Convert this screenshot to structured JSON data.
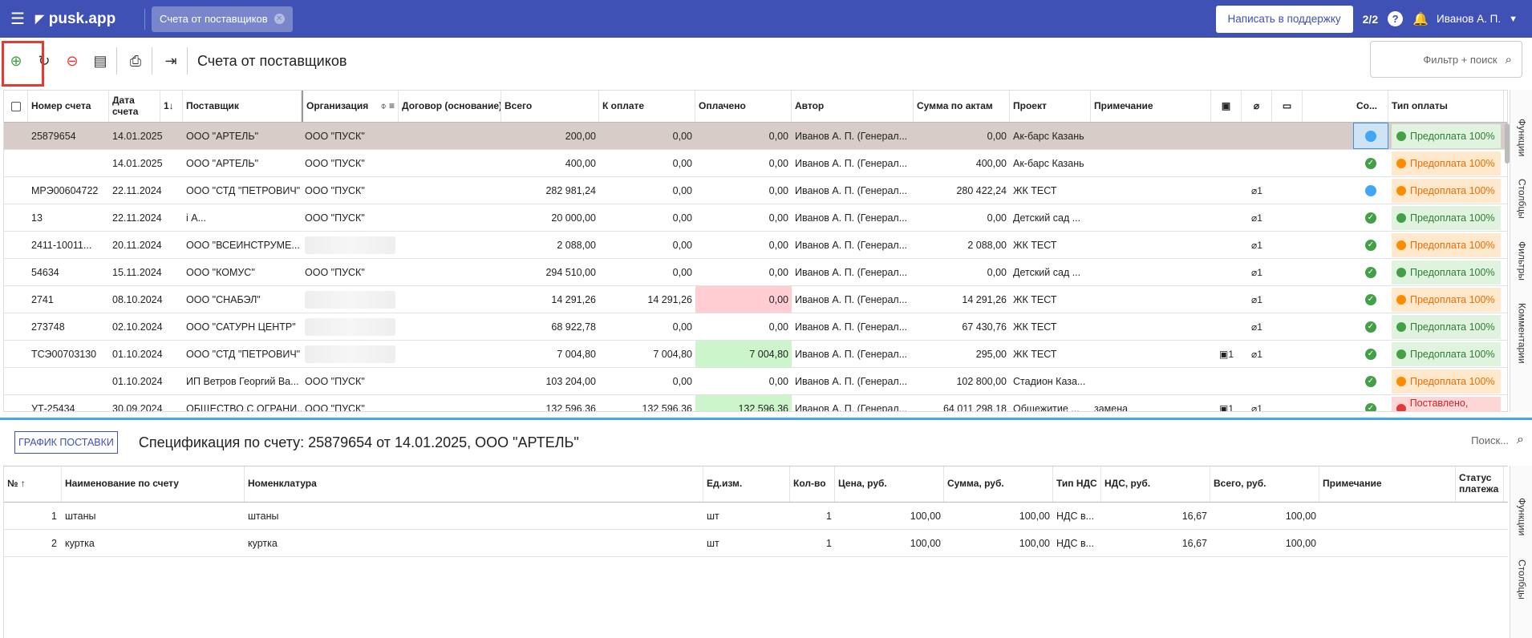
{
  "topbar": {
    "app_name": "pusk.app",
    "tab_label": "Счета от поставщиков",
    "support_label": "Написать в поддержку",
    "counter": "2/2",
    "help": "?",
    "user_name": "Иванов А. П."
  },
  "toolbar": {
    "title": "Счета от поставщиков",
    "filter_placeholder": "Фильтр + поиск"
  },
  "table": {
    "headers": {
      "number": "Номер счета",
      "date": "Дата счета",
      "sort_indicator": "1↓",
      "supplier": "Поставщик",
      "org": "Организация",
      "contract": "Договор (основание)",
      "total": "Всего",
      "to_pay": "К оплате",
      "paid": "Оплачено",
      "author": "Автор",
      "acts_sum": "Сумма по актам",
      "project": "Проект",
      "note": "Примечание",
      "status": "Со...",
      "pay_type": "Тип оплаты"
    },
    "rows": [
      {
        "number": "25879654",
        "date": "14.01.2025",
        "supplier": "ООО \"АРТЕЛЬ\"",
        "org": "ООО \"ПУСК\"",
        "total": "200,00",
        "to_pay": "0,00",
        "paid": "0,00",
        "author": "Иванов А. П. (Генерал...",
        "acts": "0,00",
        "project": "Ак-барс Казань",
        "note": "",
        "docs": "",
        "files": "",
        "status": "blue",
        "pay": "Предоплата 100%",
        "pay_color": "g"
      },
      {
        "number": "",
        "date": "14.01.2025",
        "supplier": "ООО \"АРТЕЛЬ\"",
        "org": "ООО \"ПУСК\"",
        "total": "400,00",
        "to_pay": "0,00",
        "paid": "0,00",
        "author": "Иванов А. П. (Генерал...",
        "acts": "400,00",
        "project": "Ак-барс Казань",
        "note": "",
        "docs": "",
        "files": "",
        "status": "ok",
        "pay": "Предоплата 100%",
        "pay_color": "o"
      },
      {
        "number": "МРЭ00604722",
        "date": "22.11.2024",
        "supplier": "ООО \"СТД \"ПЕТРОВИЧ\"",
        "org": "ООО \"ПУСК\"",
        "total": "282 981,24",
        "to_pay": "0,00",
        "paid": "0,00",
        "author": "Иванов А. П. (Генерал...",
        "acts": "280 422,24",
        "project": "ЖК ТЕСТ",
        "note": "",
        "docs": "",
        "files": "1",
        "status": "blue",
        "pay": "Предоплата 100%",
        "pay_color": "o"
      },
      {
        "number": "13",
        "date": "22.11.2024",
        "supplier": "i А...",
        "org": "ООО \"ПУСК\"",
        "total": "20 000,00",
        "to_pay": "0,00",
        "paid": "0,00",
        "author": "Иванов А. П. (Генерал...",
        "acts": "0,00",
        "project": "Детский сад ...",
        "note": "",
        "docs": "",
        "files": "1",
        "status": "ok",
        "pay": "Предоплата 100%",
        "pay_color": "g"
      },
      {
        "number": "2411-10011...",
        "date": "20.11.2024",
        "supplier": "ООО \"ВСЕИНСТРУМЕ...",
        "org": "",
        "total": "2 088,00",
        "to_pay": "0,00",
        "paid": "0,00",
        "author": "Иванов А. П. (Генерал...",
        "acts": "2 088,00",
        "project": "ЖК ТЕСТ",
        "note": "",
        "docs": "",
        "files": "1",
        "status": "ok",
        "pay": "Предоплата 100%",
        "pay_color": "o"
      },
      {
        "number": "54634",
        "date": "15.11.2024",
        "supplier": "ООО \"КОМУС\"",
        "org": "ООО \"ПУСК\"",
        "total": "294 510,00",
        "to_pay": "0,00",
        "paid": "0,00",
        "author": "Иванов А. П. (Генерал...",
        "acts": "0,00",
        "project": "Детский сад ...",
        "note": "",
        "docs": "",
        "files": "1",
        "status": "ok",
        "pay": "Предоплата 100%",
        "pay_color": "g"
      },
      {
        "number": "2741",
        "date": "08.10.2024",
        "supplier": "ООО \"СНАБЭЛ\"",
        "org": "",
        "total": "14 291,26",
        "to_pay": "14 291,26",
        "paid": "0,00",
        "paid_color": "pink",
        "author": "Иванов А. П. (Генерал...",
        "acts": "14 291,26",
        "project": "ЖК ТЕСТ",
        "note": "",
        "docs": "",
        "files": "1",
        "status": "ok",
        "pay": "Предоплата 100%",
        "pay_color": "o"
      },
      {
        "number": "273748",
        "date": "02.10.2024",
        "supplier": "ООО \"САТУРН ЦЕНТР\"",
        "org": "",
        "total": "68 922,78",
        "to_pay": "0,00",
        "paid": "0,00",
        "author": "Иванов А. П. (Генерал...",
        "acts": "67 430,76",
        "project": "ЖК ТЕСТ",
        "note": "",
        "docs": "",
        "files": "1",
        "status": "ok",
        "pay": "Предоплата 100%",
        "pay_color": "g"
      },
      {
        "number": "ТСЭ00703130",
        "date": "01.10.2024",
        "supplier": "ООО \"СТД \"ПЕТРОВИЧ\"",
        "org": "",
        "total": "7 004,80",
        "to_pay": "7 004,80",
        "paid": "7 004,80",
        "paid_color": "green",
        "author": "Иванов А. П. (Генерал...",
        "acts": "295,00",
        "project": "ЖК ТЕСТ",
        "note": "",
        "docs": "1",
        "files": "1",
        "status": "ok",
        "pay": "Предоплата 100%",
        "pay_color": "g"
      },
      {
        "number": "",
        "date": "01.10.2024",
        "supplier": "ИП Ветров Георгий Ва...",
        "org": "ООО \"ПУСК\"",
        "total": "103 204,00",
        "to_pay": "0,00",
        "paid": "0,00",
        "author": "Иванов А. П. (Генерал...",
        "acts": "102 800,00",
        "project": "Стадион Каза...",
        "note": "",
        "docs": "",
        "files": "",
        "status": "ok",
        "pay": "Предоплата 100%",
        "pay_color": "o"
      },
      {
        "number": "УТ-25434",
        "date": "30.09.2024",
        "supplier": "ОБЩЕСТВО С ОГРАНИ...",
        "org": "ООО \"ПУСК\"",
        "total": "132 596,36",
        "to_pay": "132 596,36",
        "paid": "132 596,36",
        "paid_color": "green",
        "author": "Иванов А. П. (Генерал...",
        "acts": "64 011 298,18",
        "project": "Общежитие ...",
        "note": "замена",
        "docs": "1",
        "files": "1",
        "status": "ok",
        "pay": "Поставлено, оплата",
        "pay_color": "r"
      }
    ]
  },
  "side_panel": {
    "functions": "Функции",
    "columns": "Столбцы",
    "filters": "Фильтры",
    "comments": "Комментарии"
  },
  "spec": {
    "schedule_button": "ГРАФИК ПОСТАВКИ",
    "title": "Спецификация по счету: 25879654 от 14.01.2025, ООО \"АРТЕЛЬ\"",
    "search_placeholder": "Поиск...",
    "headers": {
      "no": "№ ↑",
      "name": "Наименование по счету",
      "nomen": "Номенклатура",
      "unit": "Ед.изм.",
      "qty": "Кол-во",
      "price": "Цена, руб.",
      "sum": "Сумма, руб.",
      "vat_type": "Тип НДС",
      "vat": "НДС, руб.",
      "total": "Всего, руб.",
      "note": "Примечание",
      "pay_status": "Статус платежа"
    },
    "rows": [
      {
        "no": "1",
        "name": "штаны",
        "nomen": "штаны",
        "unit": "шт",
        "qty": "1",
        "price": "100,00",
        "sum": "100,00",
        "vat_type": "НДС в...",
        "vat": "16,67",
        "total": "100,00"
      },
      {
        "no": "2",
        "name": "куртка",
        "nomen": "куртка",
        "unit": "шт",
        "qty": "1",
        "price": "100,00",
        "sum": "100,00",
        "vat_type": "НДС в...",
        "vat": "16,67",
        "total": "100,00"
      }
    ]
  }
}
